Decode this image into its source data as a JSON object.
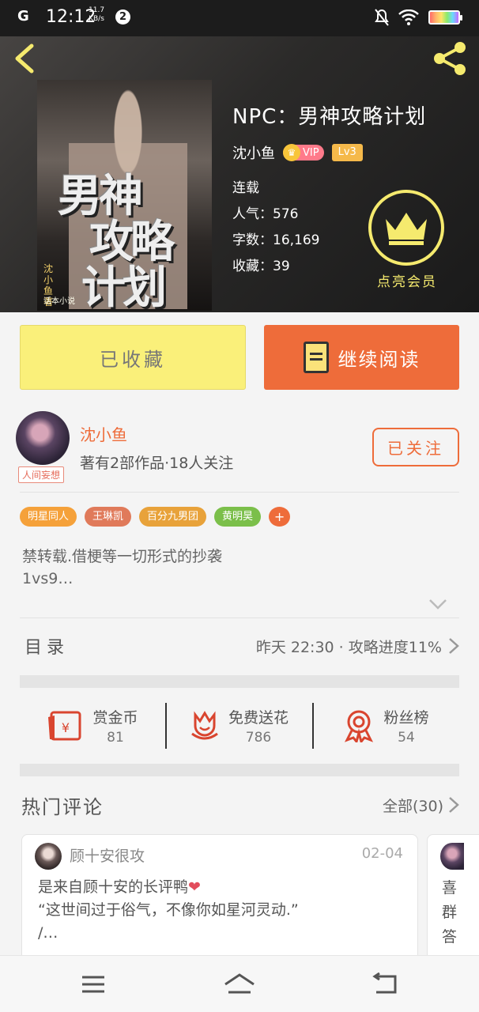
{
  "status_bar": {
    "signal": "G",
    "time": "12:12",
    "speed_top": "11.7",
    "speed_unit": "KB/s",
    "notification_count": "2"
  },
  "header": {
    "book_title": "NPC：男神攻略计划",
    "author": "沈小鱼",
    "vip_label": "VIP",
    "level": "Lv3",
    "status": "连载",
    "popularity": "人气：576",
    "word_count": "字数：16,169",
    "collections": "收藏：39",
    "member_label": "点亮会员",
    "cover": {
      "title_line1": "男神",
      "title_line2": "攻略",
      "title_line3": "计划",
      "cover_author": "沈小鱼著",
      "cover_mark": "话本小说"
    }
  },
  "actions": {
    "collected_label": "已收藏",
    "continue_label": "继续阅读"
  },
  "author_card": {
    "name": "沈小鱼",
    "subtitle": "著有2部作品·18人关注",
    "avatar_tag": "人间妄想",
    "follow_label": "已关注"
  },
  "tags": [
    {
      "label": "明星同人",
      "color": "#f5a13a"
    },
    {
      "label": "王琳凯",
      "color": "#e07a5a"
    },
    {
      "label": "百分九男团",
      "color": "#e8a23a"
    },
    {
      "label": "黄明昊",
      "color": "#7bbf4a"
    }
  ],
  "tag_more": "+",
  "description": {
    "line1": "禁转载.借梗等一切形式的抄袭",
    "line2": "1vs9…"
  },
  "toc": {
    "label": "目录",
    "update": "昨天 22:30 · 攻略进度11%"
  },
  "stats": [
    {
      "label": "赏金币",
      "value": "81",
      "icon": "red-envelope-icon"
    },
    {
      "label": "免费送花",
      "value": "786",
      "icon": "flower-icon"
    },
    {
      "label": "粉丝榜",
      "value": "54",
      "icon": "medal-icon"
    }
  ],
  "hot_comments": {
    "title": "热门评论",
    "all_label": "全部(30)"
  },
  "comment": {
    "user": "顾十安很攻",
    "date": "02-04",
    "line1": "是来自顾十安的长评鸭",
    "line2": "“这世间过于俗气，不像你如星河灵动.”",
    "line3": "/…"
  },
  "comment2": {
    "line1": "喜",
    "line2": "群",
    "line3": "答"
  },
  "colors": {
    "accent": "#ee6c3a",
    "collected_bg": "#faf07a",
    "member_gold": "#f5ea6e"
  }
}
